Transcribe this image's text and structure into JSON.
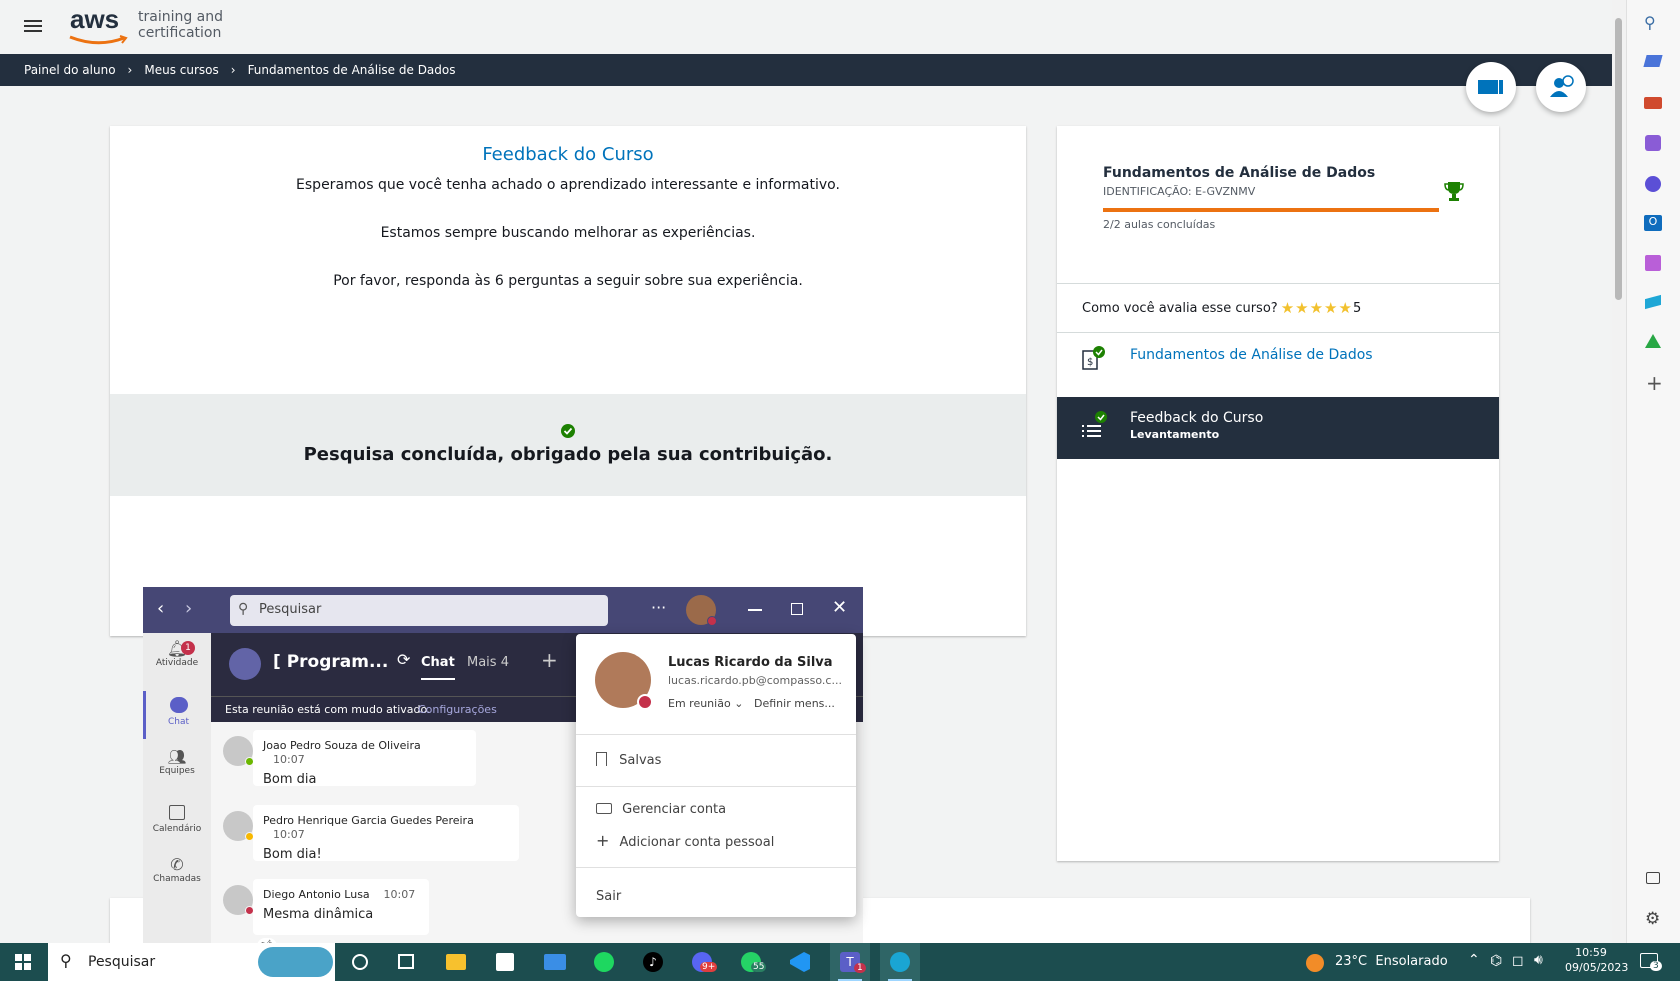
{
  "header": {
    "logo_text": "aws",
    "logo_sub1": "training and",
    "logo_sub2": "certification"
  },
  "breadcrumb": {
    "items": [
      "Painel do aluno",
      "Meus cursos",
      "Fundamentos de Análise de Dados"
    ]
  },
  "feedback": {
    "title": "Feedback do Curso",
    "line1": "Esperamos que você tenha achado o aprendizado interessante e informativo.",
    "line2": "Estamos sempre buscando melhorar as experiências.",
    "line3": "Por favor, responda às 6 perguntas a seguir sobre sua experiência.",
    "done": "Pesquisa concluída, obrigado pela sua contribuição."
  },
  "course": {
    "name": "Fundamentos de Análise de Dados",
    "id": "IDENTIFICAÇÃO: E-GVZNMV",
    "progress": 1.0,
    "lessons": "2/2 aulas concluídas",
    "rate_question": "Como você avalia esse curso?",
    "rating": "5",
    "module1": "Fundamentos de Análise de Dados",
    "module2_title": "Feedback do Curso",
    "module2_sub": "Levantamento"
  },
  "teams": {
    "search_placeholder": "Pesquisar",
    "meeting_title": "[ Program...",
    "tab_chat": "Chat",
    "tab_more": "Mais 4",
    "mute_notice": "Esta reunião está com mudo ativado.",
    "mute_link": "Configurações",
    "rail": [
      {
        "label": "Atividade",
        "badge": "1"
      },
      {
        "label": "Chat"
      },
      {
        "label": "Equipes"
      },
      {
        "label": "Calendário"
      },
      {
        "label": "Chamadas"
      }
    ],
    "messages": [
      {
        "author": "Joao Pedro Souza de Oliveira",
        "time": "10:07",
        "text": "Bom dia"
      },
      {
        "author": "Pedro Henrique Garcia Guedes Pereira",
        "time": "10:07",
        "text": "Bom dia!"
      },
      {
        "author": "Diego Antonio Lusa",
        "time": "10:07",
        "text": "Mesma dinâmica"
      }
    ],
    "reaction_count": "1",
    "profile": {
      "name": "Lucas Ricardo da Silva",
      "email": "lucas.ricardo.pb@compasso.c...",
      "status": "Em reunião",
      "set_message": "Definir mens...",
      "saved": "Salvas",
      "manage": "Gerenciar conta",
      "add_personal": "Adicionar conta pessoal",
      "signout": "Sair"
    }
  },
  "taskbar": {
    "search": "Pesquisar",
    "weather": "23°C  Ensolarado",
    "time": "10:59",
    "date": "09/05/2023",
    "discord_badge": "9+",
    "whatsapp_badge": "55",
    "teams_badge": "1",
    "notif_badge": "3"
  },
  "colors": {
    "aws_navy": "#232f3e",
    "aws_orange": "#ec7211",
    "link_blue": "#0073bb",
    "teams_purple": "#464775",
    "taskbar": "#1c4d4f"
  }
}
